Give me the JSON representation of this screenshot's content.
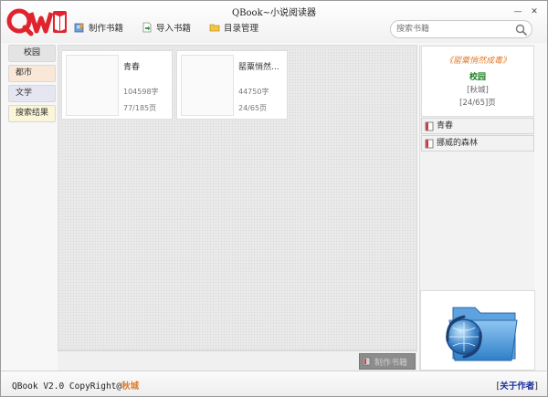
{
  "window": {
    "title": "QBook~小说阅读器",
    "minimize_glyph": "—",
    "close_glyph": "✕"
  },
  "toolbar": {
    "items": [
      {
        "label": "制作书籍",
        "icon": "make-book-icon"
      },
      {
        "label": "导入书籍",
        "icon": "import-book-icon"
      },
      {
        "label": "目录管理",
        "icon": "folder-icon"
      }
    ]
  },
  "search": {
    "placeholder": "搜索书籍",
    "value": ""
  },
  "sidebar": {
    "categories": [
      {
        "label": "校园"
      },
      {
        "label": "都市"
      },
      {
        "label": "文学"
      },
      {
        "label": "搜索结果"
      }
    ]
  },
  "books": [
    {
      "name": "青春",
      "size": "104598字",
      "pages": "77/185页"
    },
    {
      "name": "罂粟悄然...",
      "size": "44750字",
      "pages": "24/65页"
    }
  ],
  "bottom": {
    "make_button": "制作书籍"
  },
  "info": {
    "title": "《罂粟悄然成毒》",
    "category": "校园",
    "author": "[秋城]",
    "progress": "[24/65]页"
  },
  "recent": [
    {
      "label": "青春"
    },
    {
      "label": "挪威的森林"
    }
  ],
  "status": {
    "copyright_prefix": "QBook V2.0 CopyRight@",
    "copyright_author": "秋城",
    "about_open": "[",
    "about": "关于作者",
    "about_close": "]"
  },
  "colors": {
    "accent_orange": "#e07b2a",
    "category_green": "#17801d",
    "link_blue": "#1a2fa0",
    "logo_red": "#e0242e"
  }
}
